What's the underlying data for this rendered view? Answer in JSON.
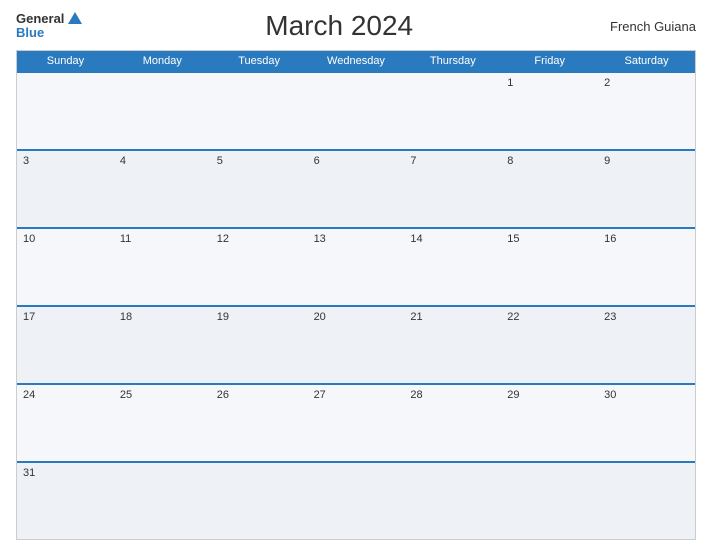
{
  "header": {
    "logo_general": "General",
    "logo_blue": "Blue",
    "title": "March 2024",
    "region": "French Guiana"
  },
  "days": [
    "Sunday",
    "Monday",
    "Tuesday",
    "Wednesday",
    "Thursday",
    "Friday",
    "Saturday"
  ],
  "weeks": [
    [
      {
        "num": "",
        "empty": true
      },
      {
        "num": "",
        "empty": true
      },
      {
        "num": "",
        "empty": true
      },
      {
        "num": "",
        "empty": true
      },
      {
        "num": "",
        "empty": true
      },
      {
        "num": "1",
        "empty": false
      },
      {
        "num": "2",
        "empty": false
      }
    ],
    [
      {
        "num": "3",
        "empty": false
      },
      {
        "num": "4",
        "empty": false
      },
      {
        "num": "5",
        "empty": false
      },
      {
        "num": "6",
        "empty": false
      },
      {
        "num": "7",
        "empty": false
      },
      {
        "num": "8",
        "empty": false
      },
      {
        "num": "9",
        "empty": false
      }
    ],
    [
      {
        "num": "10",
        "empty": false
      },
      {
        "num": "11",
        "empty": false
      },
      {
        "num": "12",
        "empty": false
      },
      {
        "num": "13",
        "empty": false
      },
      {
        "num": "14",
        "empty": false
      },
      {
        "num": "15",
        "empty": false
      },
      {
        "num": "16",
        "empty": false
      }
    ],
    [
      {
        "num": "17",
        "empty": false
      },
      {
        "num": "18",
        "empty": false
      },
      {
        "num": "19",
        "empty": false
      },
      {
        "num": "20",
        "empty": false
      },
      {
        "num": "21",
        "empty": false
      },
      {
        "num": "22",
        "empty": false
      },
      {
        "num": "23",
        "empty": false
      }
    ],
    [
      {
        "num": "24",
        "empty": false
      },
      {
        "num": "25",
        "empty": false
      },
      {
        "num": "26",
        "empty": false
      },
      {
        "num": "27",
        "empty": false
      },
      {
        "num": "28",
        "empty": false
      },
      {
        "num": "29",
        "empty": false
      },
      {
        "num": "30",
        "empty": false
      }
    ],
    [
      {
        "num": "31",
        "empty": false
      },
      {
        "num": "",
        "empty": true
      },
      {
        "num": "",
        "empty": true
      },
      {
        "num": "",
        "empty": true
      },
      {
        "num": "",
        "empty": true
      },
      {
        "num": "",
        "empty": true
      },
      {
        "num": "",
        "empty": true
      }
    ]
  ]
}
